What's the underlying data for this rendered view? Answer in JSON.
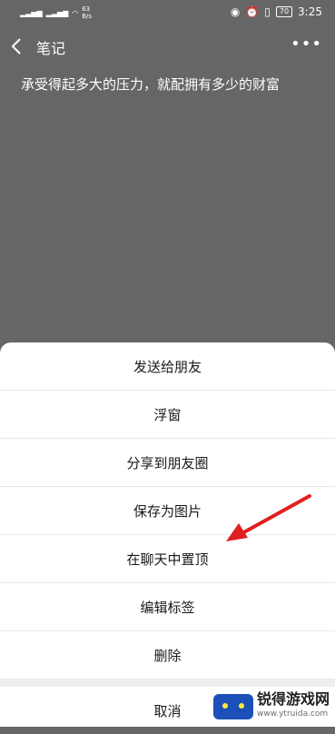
{
  "status_bar": {
    "net_speed_value": "63",
    "net_speed_unit": "B/s",
    "battery": "70",
    "time": "3:25"
  },
  "header": {
    "title": "笔记"
  },
  "note": {
    "text": "承受得起多大的压力，就配拥有多少的财富"
  },
  "action_sheet": {
    "items": [
      "发送给朋友",
      "浮窗",
      "分享到朋友圈",
      "保存为图片",
      "在聊天中置顶",
      "编辑标签",
      "删除"
    ],
    "cancel": "取消"
  },
  "watermark": {
    "name": "锐得游戏网",
    "url": "www.ytruida.com"
  },
  "colors": {
    "overlay": "#666666",
    "sheet": "#ffffff",
    "arrow": "#e02020"
  }
}
